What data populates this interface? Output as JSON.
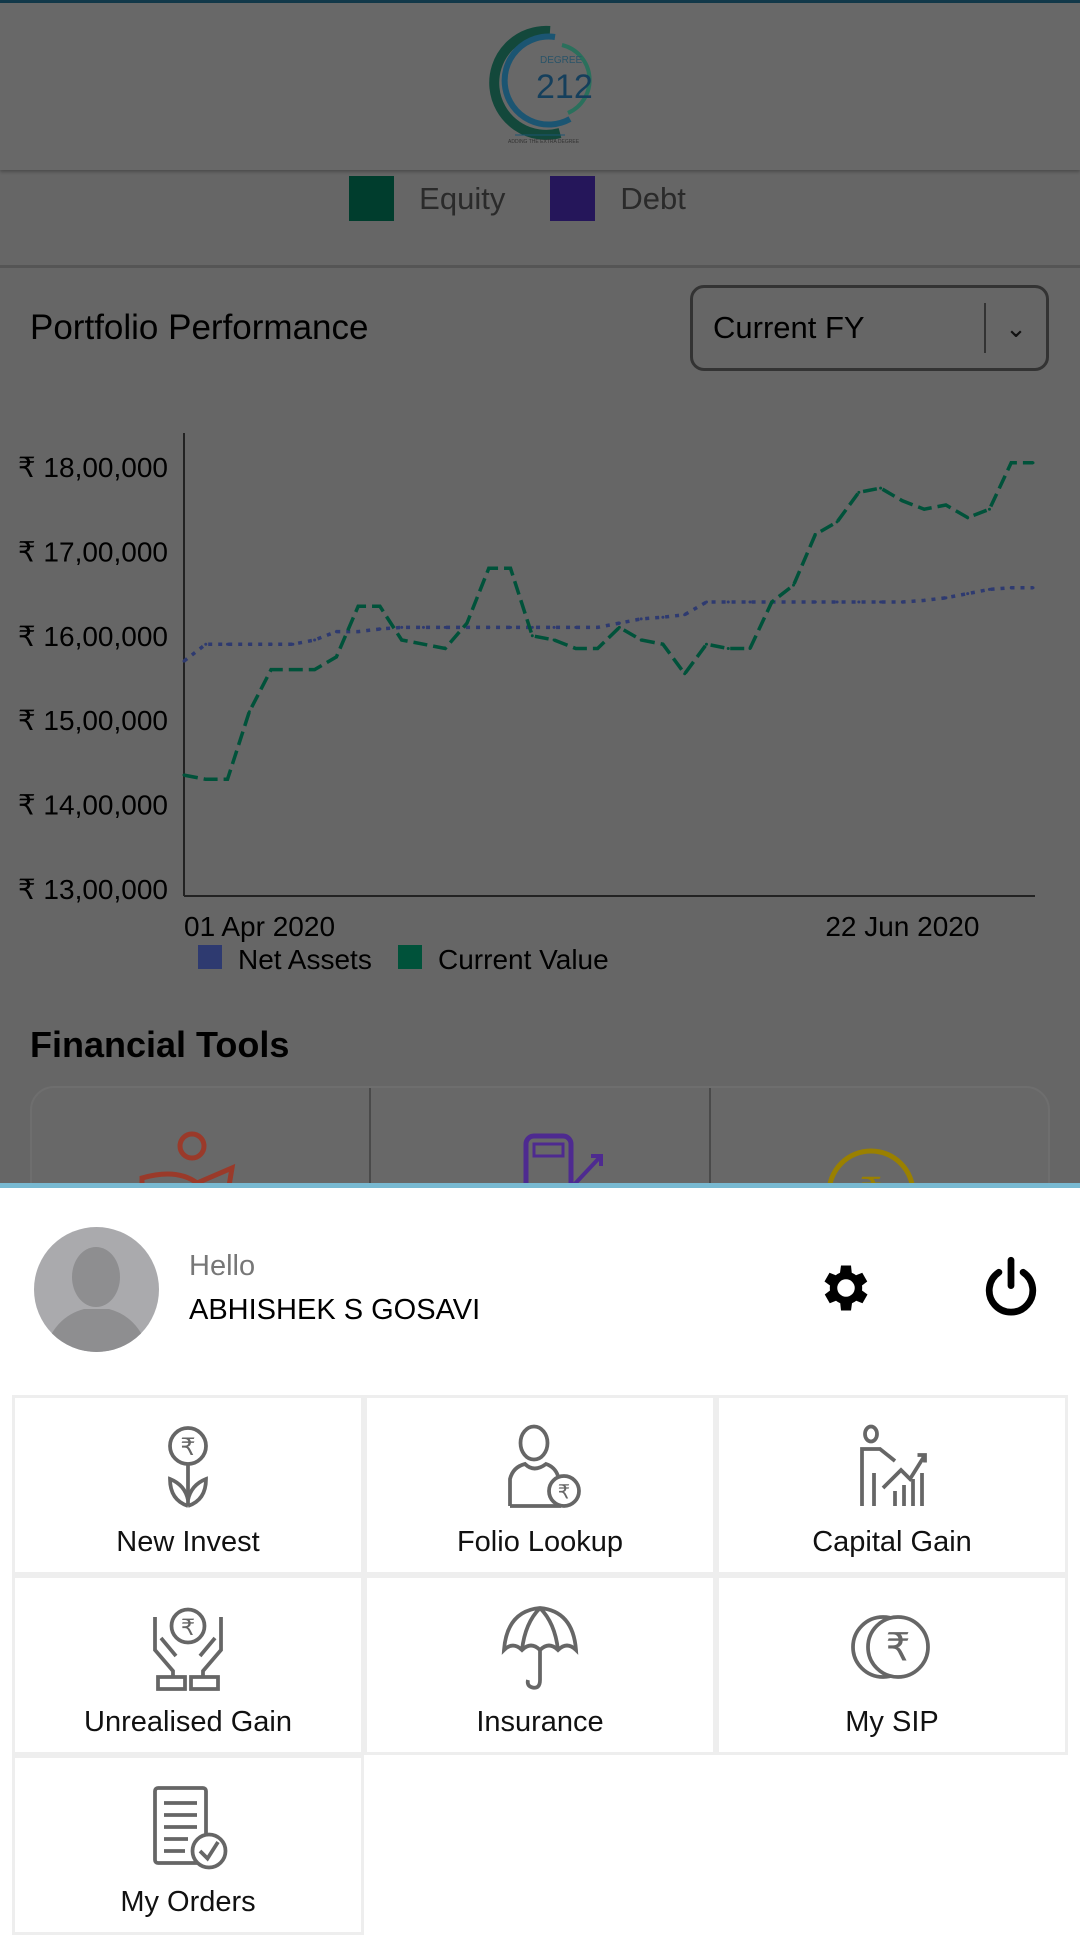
{
  "header": {
    "logo_text": "DEGREE 212",
    "logo_tagline": "ADDING THE EXTRA DEGREE"
  },
  "allocation_legend": [
    {
      "label": "Equity",
      "color": "#00694a"
    },
    {
      "label": "Debt",
      "color": "#3b1fb8"
    }
  ],
  "performance": {
    "title": "Portfolio Performance",
    "period_select": "Current FY"
  },
  "chart_data": {
    "type": "line",
    "y_ticks": [
      "₹ 18,00,000",
      "₹ 17,00,000",
      "₹ 16,00,000",
      "₹ 15,00,000",
      "₹ 14,00,000",
      "₹ 13,00,000"
    ],
    "ylim": [
      1300000,
      1800000
    ],
    "x_ticks": [
      {
        "label": "01 Apr 2020",
        "index": 0
      },
      {
        "label": "22 Jun 2020",
        "index": 33
      }
    ],
    "grid": false,
    "legend_position": "bottom-left",
    "series": [
      {
        "name": "Net Assets",
        "color": "#3a4a9c",
        "values": [
          1570000,
          1590000,
          1590000,
          1590000,
          1590000,
          1590000,
          1595000,
          1605000,
          1605000,
          1608000,
          1610000,
          1610000,
          1610000,
          1610000,
          1610000,
          1610000,
          1610000,
          1610000,
          1610000,
          1610000,
          1615000,
          1620000,
          1622000,
          1625000,
          1640000,
          1640000,
          1640000,
          1640000,
          1640000,
          1640000,
          1640000,
          1640000,
          1640000,
          1640000,
          1642000,
          1645000,
          1650000,
          1655000,
          1657000,
          1657000
        ]
      },
      {
        "name": "Current Value",
        "color": "#00734f",
        "values": [
          1435000,
          1430000,
          1430000,
          1510000,
          1560000,
          1560000,
          1560000,
          1575000,
          1635000,
          1635000,
          1595000,
          1590000,
          1585000,
          1615000,
          1680000,
          1680000,
          1600000,
          1595000,
          1585000,
          1585000,
          1610000,
          1595000,
          1590000,
          1555000,
          1590000,
          1585000,
          1585000,
          1640000,
          1660000,
          1720000,
          1735000,
          1770000,
          1775000,
          1760000,
          1750000,
          1755000,
          1740000,
          1750000,
          1805000,
          1805000
        ]
      }
    ]
  },
  "financial_tools": {
    "title": "Financial Tools"
  },
  "sheet": {
    "greeting": "Hello",
    "user_name": "ABHISHEK S GOSAVI",
    "accent_color": "#78b9d1",
    "menu": [
      {
        "label": "New Invest",
        "icon": "rupee-plant-icon"
      },
      {
        "label": "Folio Lookup",
        "icon": "user-rupee-icon"
      },
      {
        "label": "Capital Gain",
        "icon": "presenter-chart-icon"
      },
      {
        "label": "Unrealised Gain",
        "icon": "hands-rupee-icon"
      },
      {
        "label": "Insurance",
        "icon": "umbrella-icon"
      },
      {
        "label": "My SIP",
        "icon": "rupee-coins-icon"
      },
      {
        "label": "My Orders",
        "icon": "orders-checklist-icon"
      }
    ]
  }
}
